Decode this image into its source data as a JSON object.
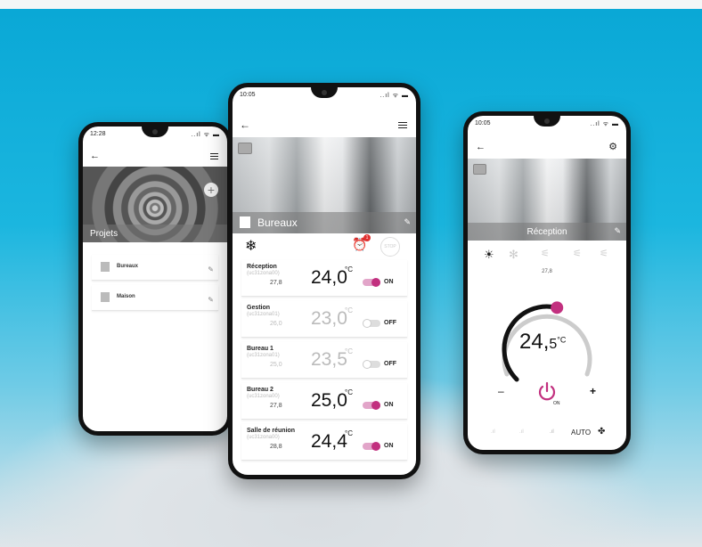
{
  "left_phone": {
    "time": "12:28",
    "signal": "..ıl ᯤ ▬",
    "header_label": "Projets",
    "projects": [
      {
        "label": "Bureaux"
      },
      {
        "label": "Maison"
      }
    ]
  },
  "center_phone": {
    "time": "10:05",
    "signal": "..ıl ᯤ ▬",
    "header_label": "Bureaux",
    "alarm_badge": "1",
    "stop_label": "STOP",
    "zones": [
      {
        "name": "Réception",
        "id": "(uc31zona00)",
        "setpoint": "27,8",
        "temp_int": "24,",
        "temp_dec": "0",
        "unit": "°C",
        "state": "ON",
        "on": true
      },
      {
        "name": "Gestion",
        "id": "(uc31zona01)",
        "setpoint": "26,0",
        "temp_int": "23,",
        "temp_dec": "0",
        "unit": "°C",
        "state": "OFF",
        "on": false
      },
      {
        "name": "Bureau 1",
        "id": "(uc31zona01)",
        "setpoint": "25,0",
        "temp_int": "23,",
        "temp_dec": "5",
        "unit": "°C",
        "state": "OFF",
        "on": false
      },
      {
        "name": "Bureau 2",
        "id": "(uc31zona00)",
        "setpoint": "27,8",
        "temp_int": "25,",
        "temp_dec": "0",
        "unit": "°C",
        "state": "ON",
        "on": true
      },
      {
        "name": "Salle de réunion",
        "id": "(uc31zona00)",
        "setpoint": "28,8",
        "temp_int": "24,",
        "temp_dec": "4",
        "unit": "°C",
        "state": "ON",
        "on": true
      }
    ]
  },
  "right_phone": {
    "time": "10:05",
    "signal": "..ıl ᯤ ▬",
    "header_label": "Réception",
    "setpoint": "27,8",
    "temp_int": "24,",
    "temp_dec": "5",
    "unit": "°C",
    "dial_level": 0.55,
    "minus": "–",
    "plus": "+",
    "power_label": "ON",
    "fan_mode": "AUTO"
  },
  "colors": {
    "accent": "#c2307f",
    "bg_top": "#0aa8d6",
    "dial_track": "#cccccc"
  }
}
